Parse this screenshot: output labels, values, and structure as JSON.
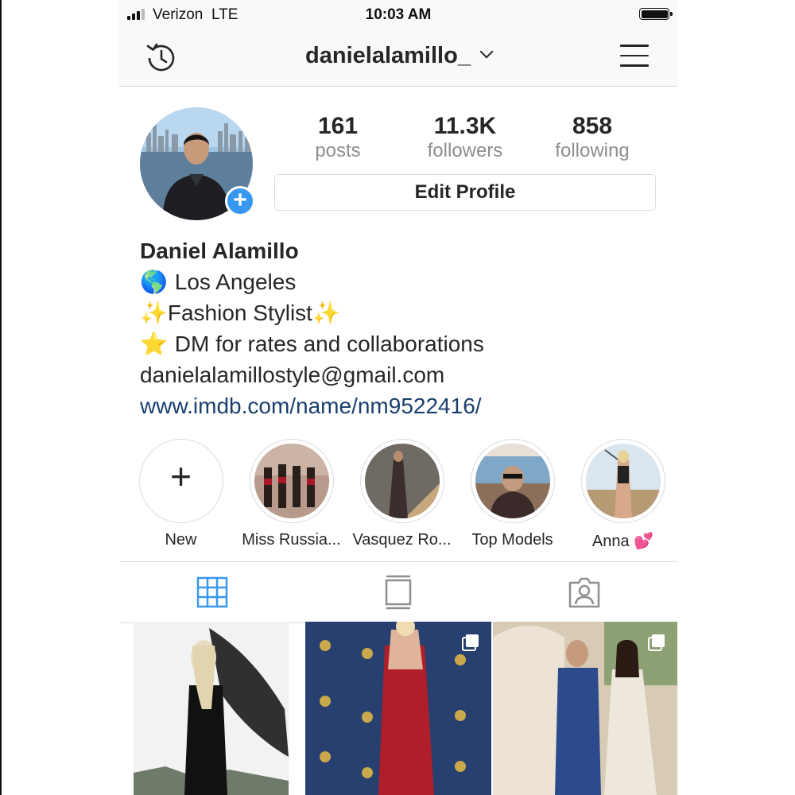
{
  "status_bar": {
    "carrier": "Verizon",
    "network": "LTE",
    "time": "10:03 AM"
  },
  "header": {
    "username": "danielalamillo_",
    "icons": [
      "history-icon",
      "chevron-down-icon",
      "menu-icon"
    ]
  },
  "profile": {
    "stats": [
      {
        "value": "161",
        "label": "posts"
      },
      {
        "value": "11.3K",
        "label": "followers"
      },
      {
        "value": "858",
        "label": "following"
      }
    ],
    "edit_label": "Edit Profile"
  },
  "bio": {
    "name": "Daniel Alamillo",
    "line1_emoji": "🌎",
    "line1_text": "Los Angeles",
    "line2_emoji_left": "✨",
    "line2_text": "Fashion Stylist",
    "line2_emoji_right": "✨",
    "line3_emoji": "⭐",
    "line3_text": "DM for rates and collaborations",
    "email": "danielalamillostyle@gmail.com",
    "website": "www.imdb.com/name/nm9522416/"
  },
  "highlights": [
    {
      "label": "New"
    },
    {
      "label": "Miss Russia..."
    },
    {
      "label": "Vasquez Ro..."
    },
    {
      "label": "Top Models"
    },
    {
      "label": "Anna 💕"
    }
  ],
  "tabs": [
    "grid-icon",
    "igtv-icon",
    "tagged-icon"
  ],
  "colors": {
    "accent": "#3897f0",
    "link": "#1a3f6e",
    "muted": "#8e8e8e",
    "text": "#262626"
  }
}
